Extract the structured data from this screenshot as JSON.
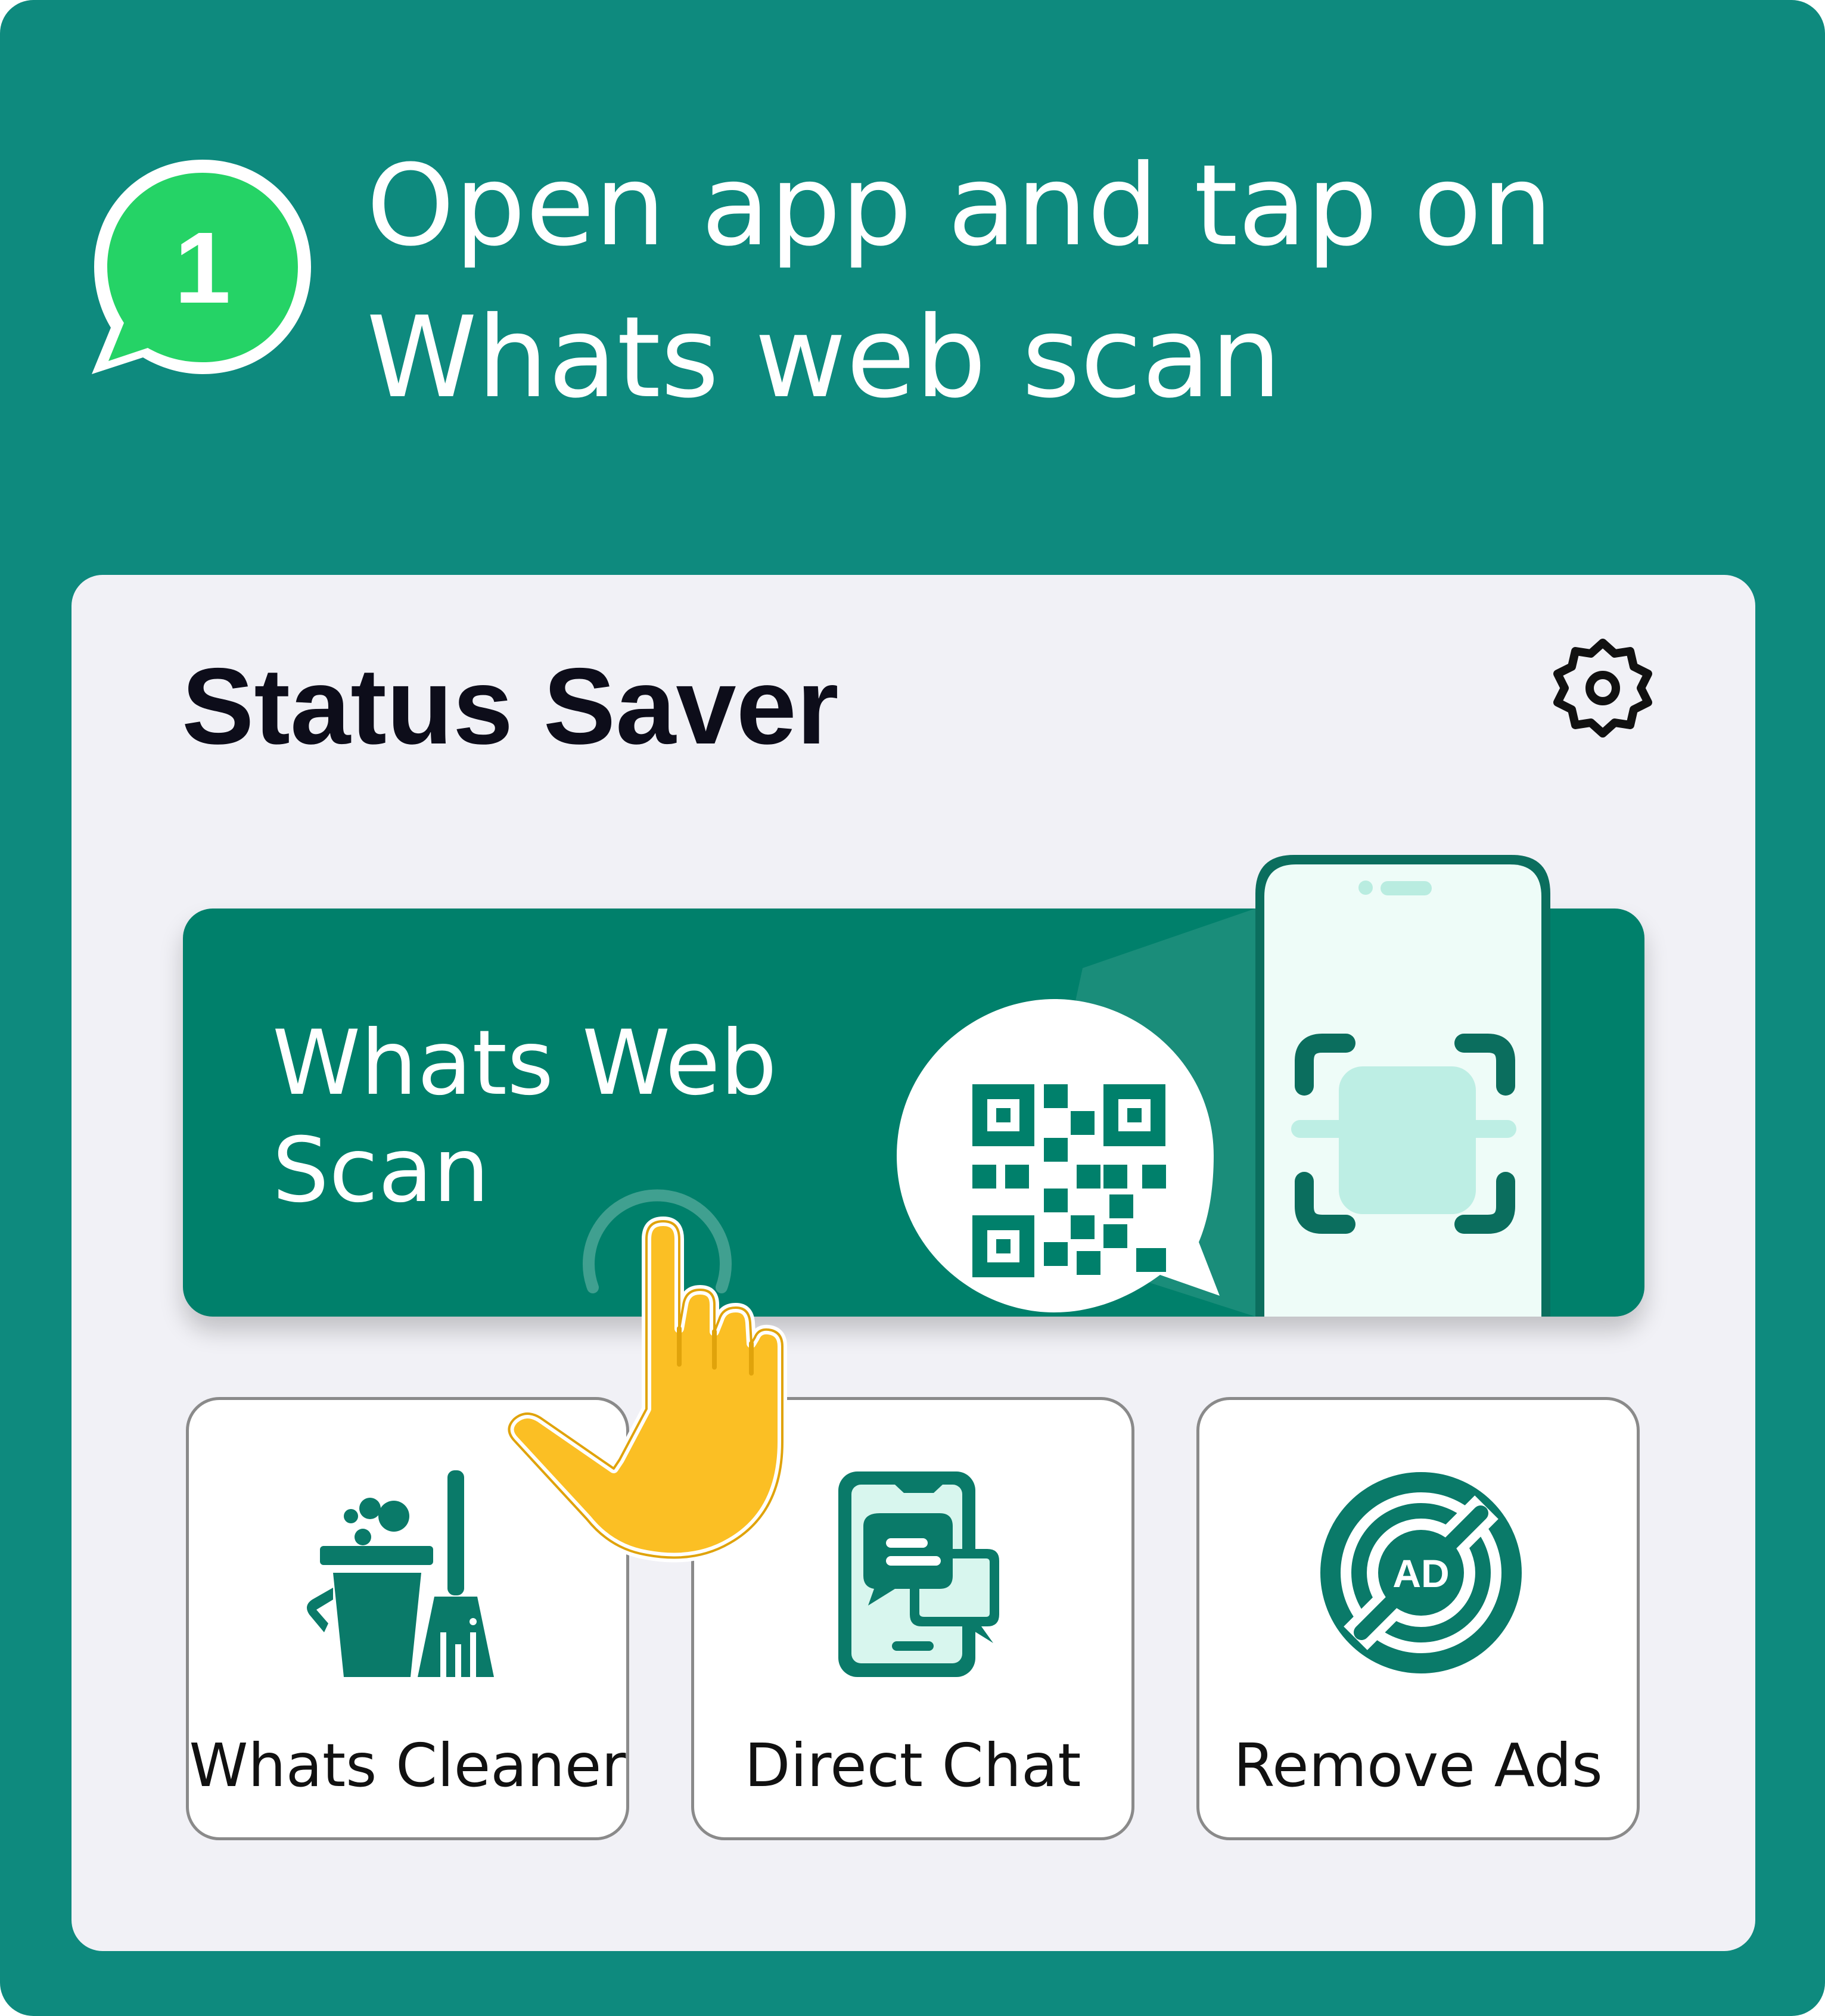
{
  "step": {
    "number": "1",
    "headline_line1": "Open app and tap on",
    "headline_line2": "Whats web scan"
  },
  "app": {
    "title": "Status Saver",
    "settings_icon": "gear-icon"
  },
  "scan_button": {
    "label_line1": "Whats Web",
    "label_line2": "Scan",
    "icons": [
      "qr-code-icon",
      "phone-icon",
      "scan-frame-icon"
    ]
  },
  "features": [
    {
      "label": "Whats Cleaner",
      "icon": "cleaning-bucket-broom-icon"
    },
    {
      "label": "Direct Chat",
      "icon": "phone-chat-icon"
    },
    {
      "label": "Remove Ads",
      "icon": "no-ads-icon"
    }
  ],
  "pointer": {
    "icon": "tap-hand-icon"
  },
  "colors": {
    "frame": "#0e8a7e",
    "card": "#f1f1f6",
    "accent": "#00806b",
    "badge": "#25d366",
    "hand": "#fbbf24"
  }
}
